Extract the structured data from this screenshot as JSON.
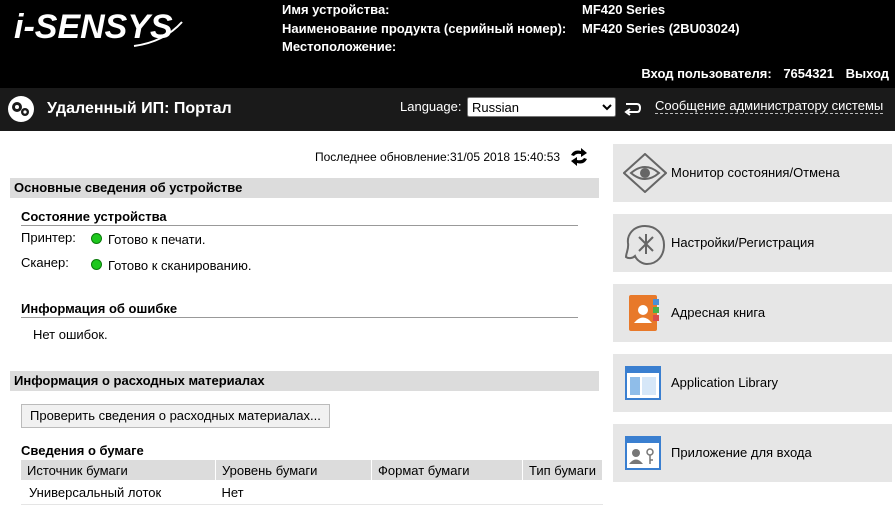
{
  "header": {
    "logo_text": "i-SENSYS",
    "device_name_label": "Имя устройства:",
    "device_name_value": "MF420 Series",
    "product_name_label": "Наименование продукта (серийный номер):",
    "product_name_value": "MF420 Series (2BU03024)",
    "location_label": "Местоположение:",
    "login_label": "Вход пользователя:",
    "login_user": "7654321",
    "logout": "Выход"
  },
  "portal_bar": {
    "title": "Удаленный ИП: Портал",
    "language_label": "Language:",
    "language_value": "Russian",
    "admin_message": "Сообщение администратору системы"
  },
  "main": {
    "last_update": "Последнее обновление:31/05 2018 15:40:53",
    "device_info_title": "Основные сведения об устройстве",
    "device_status_title": "Состояние устройства",
    "printer_label": "Принтер:",
    "printer_status": "Готово к печати.",
    "scanner_label": "Сканер:",
    "scanner_status": "Готово к сканированию.",
    "error_info_title": "Информация об ошибке",
    "error_text": "Нет ошибок.",
    "consumables_title": "Информация о расходных материалах",
    "check_button": "Проверить сведения о расходных материалах...",
    "paper_info_title": "Сведения о бумаге",
    "paper_table": {
      "columns": [
        "Источник бумаги",
        "Уровень бумаги",
        "Формат бумаги",
        "Тип бумаги"
      ],
      "rows": [
        [
          "Универсальный лоток",
          "Нет",
          "",
          ""
        ]
      ]
    }
  },
  "sidebar": {
    "items": [
      {
        "label": "Монитор состояния/Отмена",
        "icon": "eye-icon"
      },
      {
        "label": "Настройки/Регистрация",
        "icon": "settings-icon"
      },
      {
        "label": "Адресная книга",
        "icon": "address-book-icon"
      },
      {
        "label": "Application Library",
        "icon": "window-icon"
      },
      {
        "label": "Приложение для входа",
        "icon": "login-app-icon"
      }
    ]
  },
  "colors": {
    "status_green": "#1ec71e",
    "header_bg": "#000000",
    "section_bg": "#dcdcdc",
    "tile_bg": "#e6e6e6"
  }
}
